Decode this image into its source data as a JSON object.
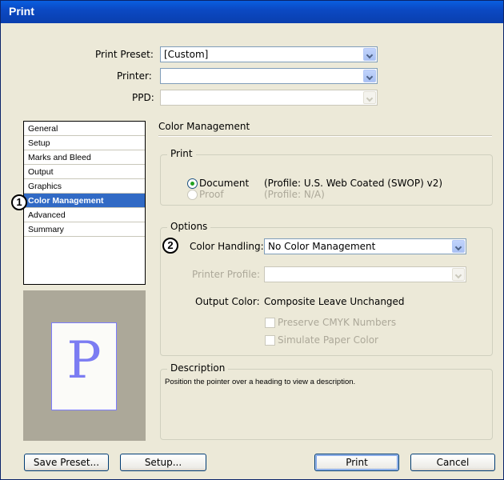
{
  "window": {
    "title": "Print"
  },
  "header": {
    "print_preset": {
      "label": "Print Preset:",
      "value": "[Custom]"
    },
    "printer": {
      "label": "Printer:",
      "value": ""
    },
    "ppd": {
      "label": "PPD:",
      "value": ""
    }
  },
  "sidebar": {
    "items": [
      {
        "label": "General",
        "selected": false
      },
      {
        "label": "Setup",
        "selected": false
      },
      {
        "label": "Marks and Bleed",
        "selected": false
      },
      {
        "label": "Output",
        "selected": false
      },
      {
        "label": "Graphics",
        "selected": false
      },
      {
        "label": "Color Management",
        "selected": true
      },
      {
        "label": "Advanced",
        "selected": false
      },
      {
        "label": "Summary",
        "selected": false
      }
    ]
  },
  "preview": {
    "glyph": "P"
  },
  "callouts": {
    "one": "1",
    "two": "2"
  },
  "section": {
    "title": "Color Management",
    "print_group": {
      "label": "Print",
      "document_label": "Document",
      "document_profile": "(Profile: U.S. Web Coated (SWOP) v2)",
      "proof_label": "Proof",
      "proof_profile": "(Profile: N/A)"
    },
    "options_group": {
      "label": "Options",
      "color_handling_label": "Color Handling:",
      "color_handling_value": "No Color Management",
      "printer_profile_label": "Printer Profile:",
      "printer_profile_value": "",
      "output_color_label": "Output Color:",
      "output_color_value": "Composite Leave Unchanged",
      "preserve_cmyk_label": "Preserve CMYK Numbers",
      "simulate_paper_label": "Simulate Paper Color"
    },
    "description_group": {
      "label": "Description",
      "text": "Position the pointer over a heading to view a description."
    }
  },
  "buttons": {
    "save_preset": "Save Preset...",
    "setup": "Setup...",
    "print": "Print",
    "cancel": "Cancel"
  },
  "colors": {
    "titlebar": "#0b49c3",
    "selection": "#316ac5",
    "radio_dot": "#21a121"
  }
}
